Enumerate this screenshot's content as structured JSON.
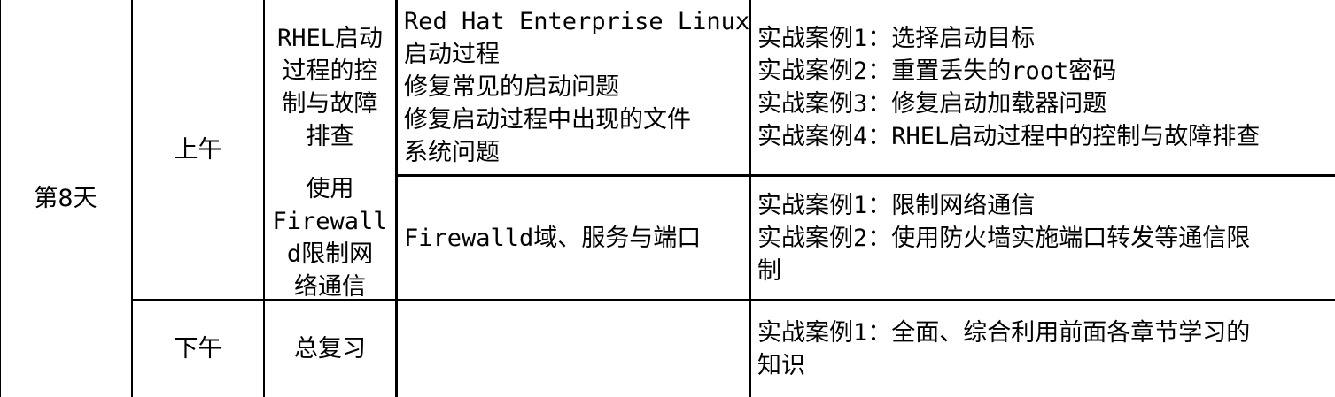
{
  "table": {
    "day": "第8天",
    "periods": {
      "morning": "上午",
      "afternoon": "下午"
    },
    "rows": [
      {
        "topic_lines": [
          "RHEL启动",
          "过程的控",
          "制与故障",
          "排查"
        ],
        "content_lines": [
          "Red Hat Enterprise Linux",
          "启动过程",
          "修复常见的启动问题",
          "修复启动过程中出现的文件",
          "系统问题"
        ],
        "case_lines": [
          "实战案例1：选择启动目标",
          "实战案例2：重置丢失的root密码",
          "实战案例3：修复启动加载器问题",
          "实战案例4：RHEL启动过程中的控制与故障排查"
        ]
      },
      {
        "topic_lines": [
          "使用",
          "Firewall",
          "d限制网",
          "络通信"
        ],
        "content_lines": [
          "Firewalld域、服务与端口"
        ],
        "case_lines": [
          "实战案例1：限制网络通信",
          "实战案例2：使用防火墙实施端口转发等通信限",
          "制"
        ]
      },
      {
        "topic_lines": [
          "总复习"
        ],
        "content_lines": [],
        "case_lines": [
          "实战案例1：全面、综合利用前面各章节学习的",
          "知识"
        ]
      }
    ]
  }
}
